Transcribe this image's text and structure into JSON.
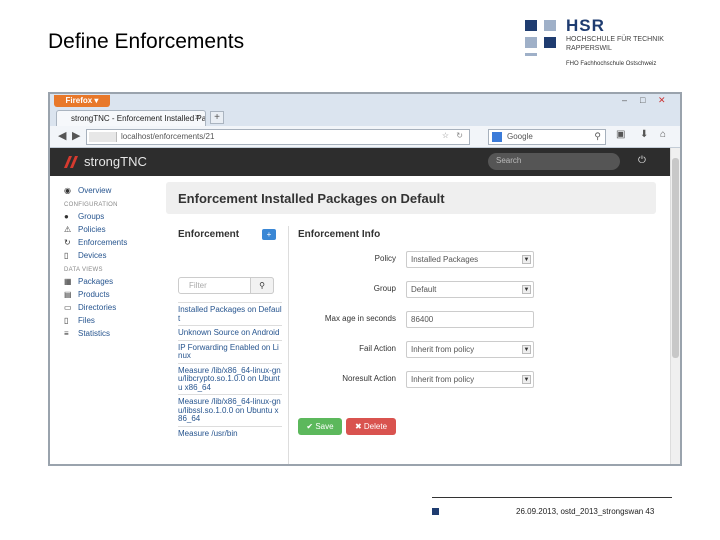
{
  "slide": {
    "title": "Define Enforcements",
    "footer": "26.09.2013, ostd_2013_strongswan 43"
  },
  "logo": {
    "name": "HSR",
    "line1": "HOCHSCHULE FÜR TECHNIK",
    "line2": "RAPPERSWIL",
    "line3": "FHO Fachhochschule Ostschweiz",
    "colors": {
      "dark": "#1f3c70",
      "light": "#9fb0c8"
    }
  },
  "browser": {
    "menu_button": "Firefox",
    "tab_title": "strongTNC - Enforcement Installed Pack...",
    "url": "localhost/enforcements/21",
    "search_engine": "Google"
  },
  "app": {
    "brand": "strongTNC",
    "search_placeholder": "Search",
    "sidebar": {
      "overview": "Overview",
      "configuration_header": "CONFIGURATION",
      "groups": "Groups",
      "policies": "Policies",
      "enforcements": "Enforcements",
      "devices": "Devices",
      "data_views_header": "DATA VIEWS",
      "packages": "Packages",
      "products": "Products",
      "directories": "Directories",
      "files": "Files",
      "statistics": "Statistics"
    },
    "page_heading": "Enforcement Installed Packages on Default",
    "enforcement_list": {
      "title": "Enforcement",
      "add_label": "+",
      "filter_placeholder": "Filter",
      "items": [
        "Installed Packages on Default",
        "Unknown Source on Android",
        "IP Forwarding Enabled on Linux",
        "Measure /lib/x86_64-linux-gnu/libcrypto.so.1.0.0 on Ubuntu x86_64",
        "Measure /lib/x86_64-linux-gnu/libssl.so.1.0.0 on Ubuntu x86_64",
        "Measure /usr/bin"
      ]
    },
    "enforcement_info": {
      "title": "Enforcement Info",
      "policy_label": "Policy",
      "policy_value": "Installed Packages",
      "group_label": "Group",
      "group_value": "Default",
      "max_age_label": "Max age in seconds",
      "max_age_value": "86400",
      "fail_action_label": "Fail Action",
      "fail_action_value": "Inherit from policy",
      "noresult_action_label": "Noresult Action",
      "noresult_action_value": "Inherit from policy",
      "save_label": "Save",
      "delete_label": "Delete"
    }
  }
}
